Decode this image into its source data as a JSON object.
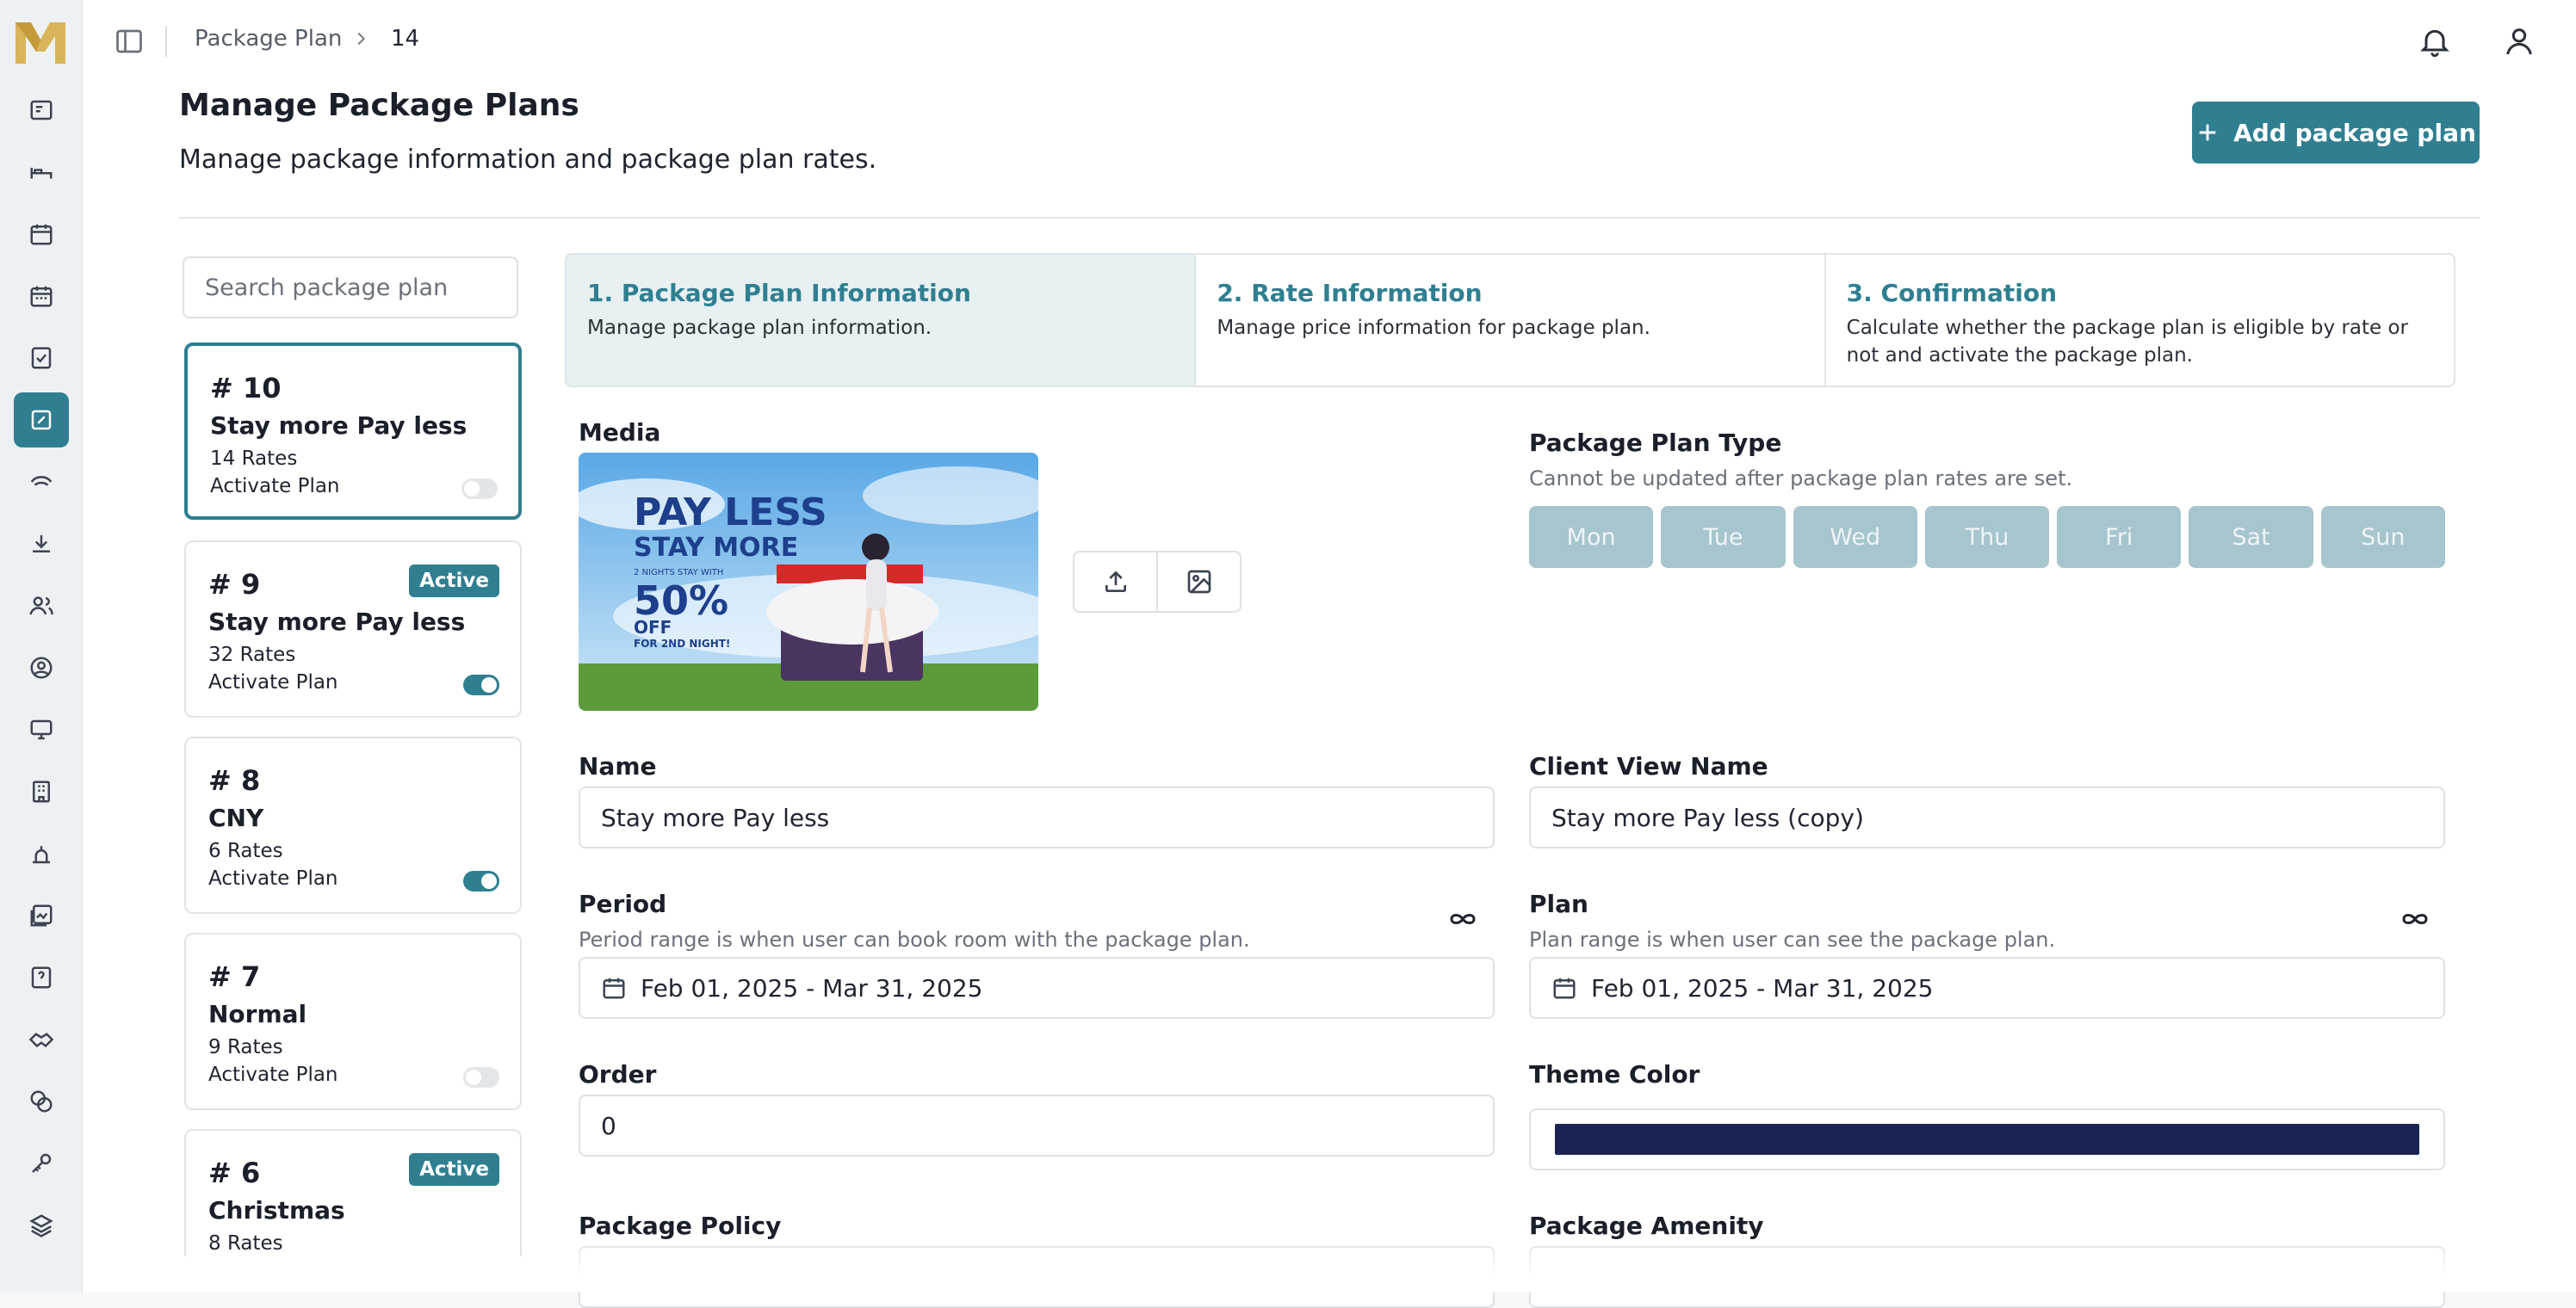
{
  "breadcrumb": {
    "root": "Package Plan",
    "current": "14"
  },
  "header": {
    "title": "Manage Package Plans",
    "subtitle": "Manage package information and package plan rates.",
    "add_button": "Add package plan"
  },
  "search": {
    "placeholder": "Search package plan"
  },
  "plans": [
    {
      "number": "# 10",
      "name": "Stay more Pay less",
      "rates": "14 Rates",
      "activate_label": "Activate Plan",
      "badge": "",
      "active": false,
      "selected": true
    },
    {
      "number": "# 9",
      "name": "Stay more Pay less",
      "rates": "32 Rates",
      "activate_label": "Activate Plan",
      "badge": "Active",
      "active": true,
      "selected": false
    },
    {
      "number": "# 8",
      "name": "CNY",
      "rates": "6 Rates",
      "activate_label": "Activate Plan",
      "badge": "",
      "active": true,
      "selected": false
    },
    {
      "number": "# 7",
      "name": "Normal",
      "rates": "9 Rates",
      "activate_label": "Activate Plan",
      "badge": "",
      "active": false,
      "selected": false
    },
    {
      "number": "# 6",
      "name": "Christmas",
      "rates": "8 Rates",
      "activate_label": "",
      "badge": "Active",
      "active": true,
      "selected": false
    }
  ],
  "steps": [
    {
      "title": "1. Package Plan Information",
      "desc": "Manage package plan information."
    },
    {
      "title": "2. Rate Information",
      "desc": "Manage price information for package plan."
    },
    {
      "title": "3. Confirmation",
      "desc": "Calculate whether the package plan is eligible by rate or not and activate the package plan."
    }
  ],
  "form": {
    "media_label": "Media",
    "banner": {
      "line1": "PAY LESS",
      "line2": "STAY MORE",
      "small": "2 NIGHTS STAY WITH",
      "pct": "50%",
      "off": "OFF",
      "foot": "FOR 2ND NIGHT!"
    },
    "type_label": "Package Plan Type",
    "type_hint": "Cannot be updated after package plan rates are set.",
    "days": [
      "Mon",
      "Tue",
      "Wed",
      "Thu",
      "Fri",
      "Sat",
      "Sun"
    ],
    "name_label": "Name",
    "name_value": "Stay more Pay less",
    "client_name_label": "Client View Name",
    "client_name_value": "Stay more Pay less (copy)",
    "period_label": "Period",
    "period_hint": "Period range is when user can book room with the package plan.",
    "period_value": "Feb 01, 2025 - Mar 31, 2025",
    "plan_label": "Plan",
    "plan_hint": "Plan range is when user can see the package plan.",
    "plan_value": "Feb 01, 2025 - Mar 31, 2025",
    "order_label": "Order",
    "order_value": "0",
    "theme_label": "Theme Color",
    "theme_color": "#1b2452",
    "policy_label": "Package Policy",
    "amenity_label": "Package Amenity"
  },
  "colors": {
    "accent": "#2f7f91",
    "day_disabled": "#a7c5cd"
  },
  "icons": [
    "logo-icon",
    "sidebar-toggle-icon",
    "chevron-right-icon",
    "bell-icon",
    "user-icon",
    "plus-icon",
    "upload-icon",
    "image-icon",
    "calendar-icon",
    "infinity-icon"
  ]
}
